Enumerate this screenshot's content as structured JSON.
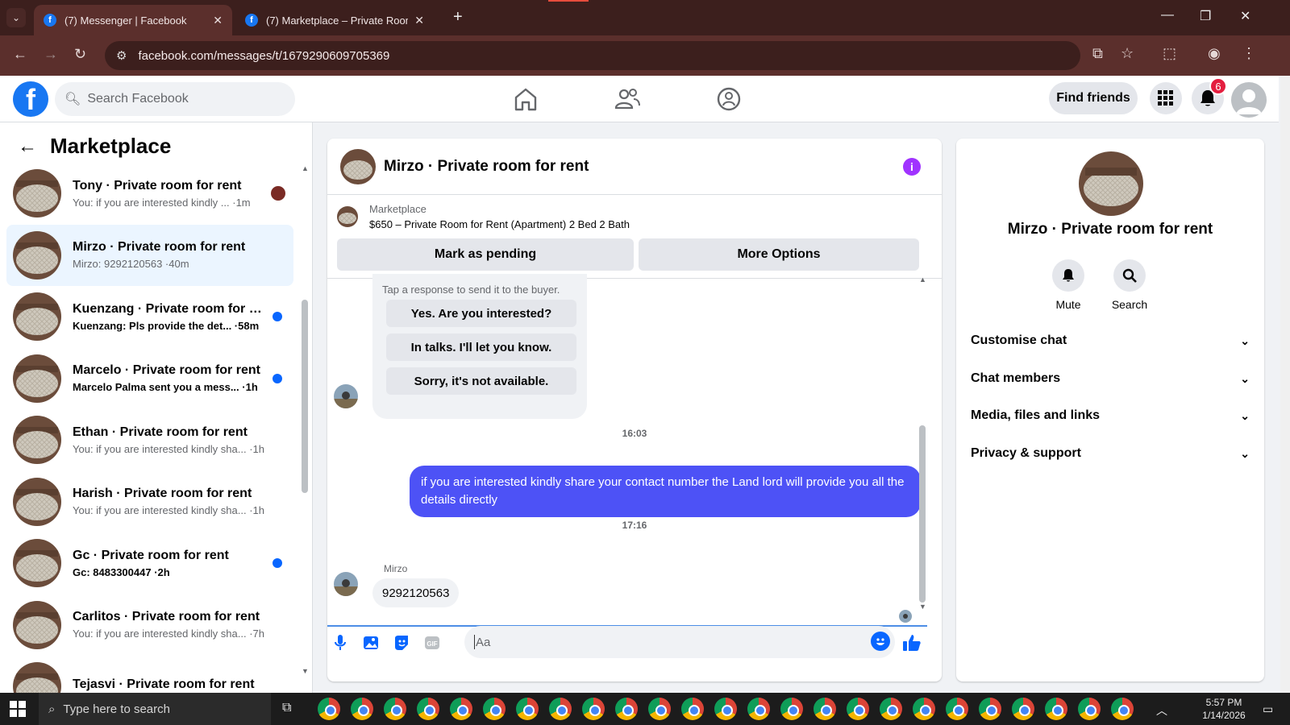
{
  "browser": {
    "tabs": [
      {
        "title": "(7) Messenger | Facebook",
        "active": true
      },
      {
        "title": "(7) Marketplace – Private Room fo",
        "active": false
      }
    ],
    "url": "facebook.com/messages/t/1679290609705369"
  },
  "fb_header": {
    "search_placeholder": "Search Facebook",
    "find_friends": "Find friends",
    "notification_count": "6"
  },
  "sidebar": {
    "title": "Marketplace",
    "conversations": [
      {
        "name": "Tony · Private room for rent",
        "preview": "You: if you are interested kindly ... ·1m",
        "unread": false,
        "selected": false
      },
      {
        "name": "Mirzo · Private room for rent",
        "preview": "Mirzo: 9292120563 ·40m",
        "unread": false,
        "selected": true
      },
      {
        "name": "Kuenzang · Private room for re...",
        "preview": "Kuenzang: Pls provide the det... ·58m",
        "unread": true,
        "selected": false
      },
      {
        "name": "Marcelo · Private room for rent",
        "preview": "Marcelo Palma sent you a mess... ·1h",
        "unread": true,
        "selected": false
      },
      {
        "name": "Ethan · Private room for rent",
        "preview": "You: if you are interested kindly sha... ·1h",
        "unread": false,
        "selected": false
      },
      {
        "name": "Harish · Private room for rent",
        "preview": "You: if you are interested kindly sha... ·1h",
        "unread": false,
        "selected": false
      },
      {
        "name": "Gc · Private room for rent",
        "preview": "Gc: 8483300447 ·2h",
        "unread": true,
        "selected": false
      },
      {
        "name": "Carlitos · Private room for rent",
        "preview": "You: if you are interested kindly sha... ·7h",
        "unread": false,
        "selected": false
      },
      {
        "name": "Tejasvi · Private room for rent",
        "preview": "",
        "unread": false,
        "selected": false
      }
    ]
  },
  "chat": {
    "title": "Mirzo · Private room for rent",
    "listing_label": "Marketplace",
    "listing_title": "$650 – Private Room for Rent (Apartment) 2 Bed 2 Bath",
    "mark_pending": "Mark as pending",
    "more_options": "More Options",
    "quick_hint": "Tap a response to send it to the buyer.",
    "quick_replies": [
      "Yes. Are you interested?",
      "In talks. I'll let you know.",
      "Sorry, it's not available."
    ],
    "time1": "16:03",
    "outgoing": "if you are interested kindly share your contact number the Land lord will provide you all the details directly",
    "time2": "17:16",
    "sender": "Mirzo",
    "incoming": "9292120563",
    "input_placeholder": "Aa"
  },
  "details": {
    "name": "Mirzo · Private room for rent",
    "mute": "Mute",
    "search": "Search",
    "sections": [
      "Customise chat",
      "Chat members",
      "Media, files and links",
      "Privacy & support"
    ]
  },
  "taskbar": {
    "search": "Type here to search",
    "time": "5:57 PM",
    "date": "1/14/2026"
  },
  "colors": {
    "brand": "#1877f2",
    "outgoing_bubble": "#4d52f6",
    "unread_dot": "#0866ff",
    "chrome_bg": "#3c1f1d"
  }
}
